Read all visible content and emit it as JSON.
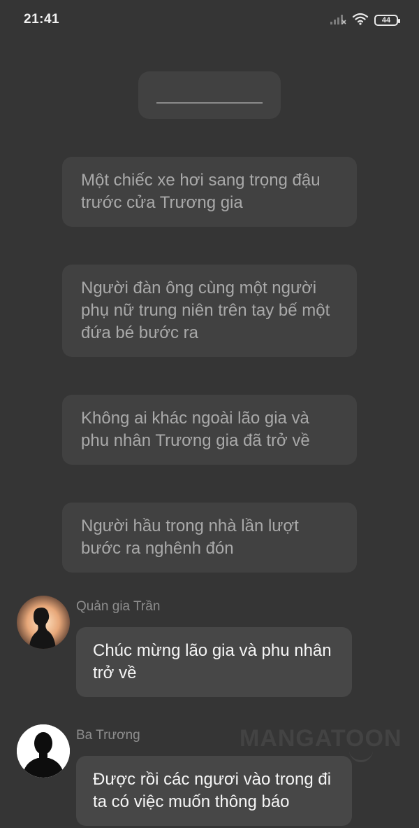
{
  "status_bar": {
    "time": "21:41",
    "battery_level": "44"
  },
  "narrations": [
    {
      "text": "Một chiếc xe hơi sang trọng đậu trước cửa Trương gia"
    },
    {
      "text": "Người đàn ông cùng một người phụ nữ trung niên trên tay bế một đứa bé bước ra"
    },
    {
      "text": "Không ai khác ngoài lão gia và phu nhân Trương gia đã trở về"
    },
    {
      "text": "Người hầu trong nhà lần lượt bước ra nghênh đón"
    }
  ],
  "messages": [
    {
      "speaker": "Quản gia Trần",
      "text": "Chúc mừng lão gia và phu nhân trở về"
    },
    {
      "speaker": "Ba Trương",
      "text": "Được rồi các ngươi vào trong đi ta có việc muốn thông báo"
    }
  ],
  "watermark": "MANGATOON"
}
